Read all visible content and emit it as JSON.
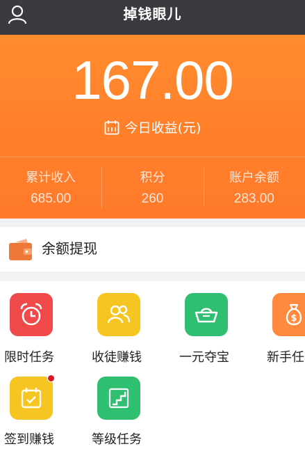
{
  "header": {
    "title": "掉钱眼儿",
    "user_icon": "user-icon"
  },
  "earnings": {
    "amount": "167.00",
    "today_label": "今日收益(元)",
    "calendar_icon": "calendar-icon"
  },
  "stats": [
    {
      "label": "累计收入",
      "value": "685.00"
    },
    {
      "label": "积分",
      "value": "260"
    },
    {
      "label": "账户余额",
      "value": "283.00"
    }
  ],
  "withdraw": {
    "label": "余额提现",
    "icon": "wallet-icon"
  },
  "tiles": [
    {
      "label": "限时任务",
      "icon": "alarm-clock-icon",
      "color": "#f04a4a"
    },
    {
      "label": "收徒赚钱",
      "icon": "people-icon",
      "color": "#f6c521"
    },
    {
      "label": "一元夺宝",
      "icon": "gold-ingot-icon",
      "color": "#2fbf71"
    },
    {
      "label": "新手任",
      "icon": "money-bag-icon",
      "color": "#ff8a3d"
    },
    {
      "label": "签到赚钱",
      "icon": "calendar-check-icon",
      "color": "#f6c521",
      "badge": true
    },
    {
      "label": "等级任务",
      "icon": "stairs-icon",
      "color": "#2fbf71"
    }
  ],
  "colors": {
    "header_bg": "#3a3b3f",
    "hero_orange": "#ff8030",
    "page_gap": "#f2f2f4"
  }
}
